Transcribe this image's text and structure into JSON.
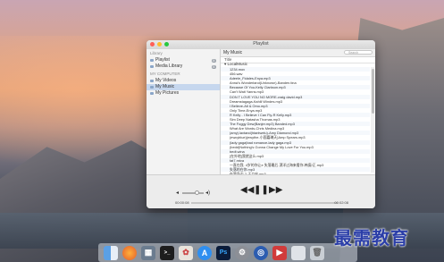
{
  "window": {
    "title": "Playlist"
  },
  "sidebar": {
    "library_heading": "Library",
    "library_items": [
      {
        "label": "Playlist",
        "badge": "8"
      },
      {
        "label": "Media Library",
        "badge": "8"
      }
    ],
    "computer_heading": "MY COMPUTER",
    "computer_items": [
      {
        "label": "My Videos"
      },
      {
        "label": "My Music"
      },
      {
        "label": "My Pictures"
      }
    ]
  },
  "content": {
    "title": "My Music",
    "search_placeholder": "Search",
    "column_header": "Title",
    "folder": "▾ LocalMusic",
    "tracks": [
      "1234.mov",
      "456.wav",
      "Adeele_Fidales-Enya.mp3",
      "Anna's Wonderland(Unknown)-Banden.tina",
      "Because Of You-Kelly Clarkson.mp3",
      "Can't Wait Yanns.mp3",
      "DON T LOVE YOU NO MORE-craig david.mp3",
      "Dreamstagaga-Kahlil Windes.mp3",
      "I Believe-Alt & Omo.mp3",
      "Only Time-Enya.mp3",
      "R Kelly - I Believe I Can Fly-R Kelly.mp3",
      "Sim Deep Natasha Thomas.mp3",
      "The Foggy Dew(Banjer.mp3) Banded.mp3",
      "What Are Words-Chris Medina.mp3",
      "(amy).lavtand(htantwelu)-Amy Diamond.mp3",
      "(ewcyblue)(ewythe-小国嘉琳天)Amp Spears.mp3",
      "(lady gaga)bad romance-lady gaga.mp3",
      "(bedd)Nothing's Gonna Change My Love For You.mp3",
      "bedt.wina",
      "[在外地]我就这么.mp3",
      "fat7.mtva",
      "一直在我. 4岁的你让e 失落最后.漂洋过海来看你-韩庚/正.mp3",
      "失落的在你.mp3",
      "在我身边-2-王力宏.mp3"
    ]
  },
  "player": {
    "time_elapsed": "00:00:08",
    "time_total": "00:02:08",
    "volume_low_icon": "speaker-low-icon",
    "volume_high_icon": "speaker-high-icon",
    "prev_icon": "rewind-icon",
    "pause_icon": "pause-icon",
    "next_icon": "fast-forward-icon"
  },
  "dock": {
    "icons": [
      "finder-icon",
      "firefox-icon",
      "launchpad-icon",
      "terminal-icon",
      "photos-icon",
      "app-store-icon",
      "photoshop-icon",
      "system-preferences-icon",
      "network-icon",
      "player-icon",
      "window-icon",
      "trash-icon"
    ]
  },
  "watermark": "最需教育"
}
